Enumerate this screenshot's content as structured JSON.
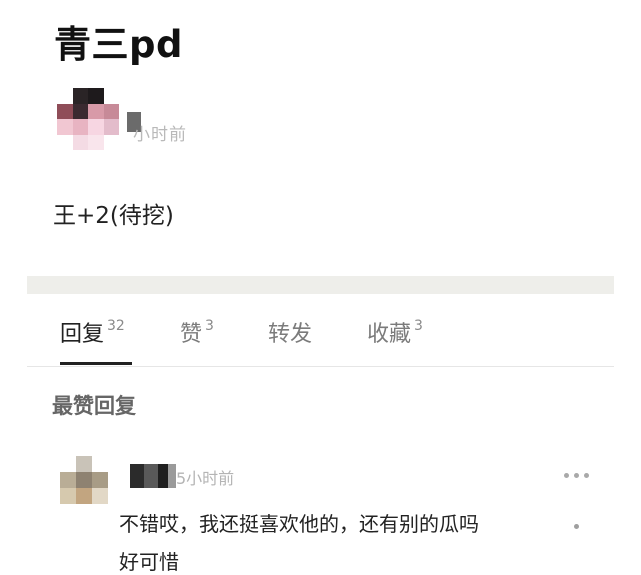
{
  "post": {
    "title": "青三pd",
    "time": "小时前",
    "body": "王+2(待挖)"
  },
  "tabs": [
    {
      "label": "回复",
      "count": "32"
    },
    {
      "label": "赞",
      "count": "3"
    },
    {
      "label": "转发",
      "count": ""
    },
    {
      "label": "收藏",
      "count": "3"
    }
  ],
  "section": {
    "title": "最赞回复"
  },
  "comment": {
    "time": "5小时前",
    "text": "不错哎，我还挺喜欢他的，还有别的瓜吗",
    "text_line2": "好可惜"
  },
  "colors": {
    "background": "#ffffff",
    "divider_band": "#eeeeea",
    "muted_text": "#b9b9b9"
  },
  "icons": {
    "more": "more-horizontal-icon"
  }
}
